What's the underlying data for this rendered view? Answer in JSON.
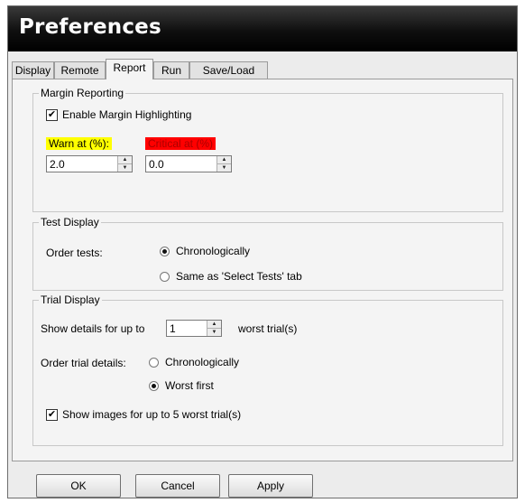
{
  "window": {
    "title": "Preferences"
  },
  "tabs": [
    {
      "label": "Display",
      "active": false
    },
    {
      "label": "Remote",
      "active": false
    },
    {
      "label": "Report",
      "active": true
    },
    {
      "label": "Run",
      "active": false
    },
    {
      "label": "Save/Load",
      "active": false
    }
  ],
  "margin": {
    "legend": "Margin Reporting",
    "enable_label": "Enable Margin Highlighting",
    "enable_checked": true,
    "warn_label": "Warn at (%):",
    "warn_value": "2.0",
    "warn_color": "#ffff00",
    "critical_label": "Critical at (%)",
    "critical_value": "0.0",
    "critical_color": "#ff0000"
  },
  "test_display": {
    "legend": "Test Display",
    "order_label": "Order tests:",
    "opt1": "Chronologically",
    "opt2": "Same as 'Select Tests' tab",
    "selected": "Chronologically"
  },
  "trial_display": {
    "legend": "Trial Display",
    "show_prefix": "Show details for up to",
    "show_value": "1",
    "show_suffix": "worst trial(s)",
    "order_label": "Order trial details:",
    "opt1": "Chronologically",
    "opt2": "Worst first",
    "selected": "Worst first",
    "images_label": "Show images for up to 5 worst trial(s)",
    "images_checked": true
  },
  "buttons": {
    "ok": "OK",
    "cancel": "Cancel",
    "apply": "Apply"
  }
}
